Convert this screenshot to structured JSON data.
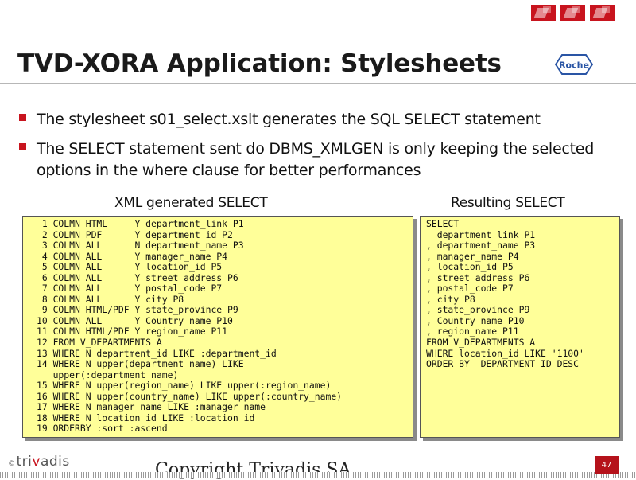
{
  "slide": {
    "title": "TVD-XORA Application: Stylesheets",
    "partner_logo_text": "Roche",
    "bullets": [
      "The stylesheet s01_select.xslt generates the SQL SELECT statement",
      "The SELECT statement sent do DBMS_XMLGEN is only keeping the selected options in the where clause for better performances"
    ]
  },
  "left_panel": {
    "heading": "XML generated SELECT",
    "lines": [
      " 1 COLMN HTML     Y department_link P1",
      " 2 COLMN PDF      Y department_id P2",
      " 3 COLMN ALL      N department_name P3",
      " 4 COLMN ALL      Y manager_name P4",
      " 5 COLMN ALL      Y location_id P5",
      " 6 COLMN ALL      Y street_address P6",
      " 7 COLMN ALL      Y postal_code P7",
      " 8 COLMN ALL      Y city P8",
      " 9 COLMN HTML/PDF Y state_province P9",
      "10 COLMN ALL      Y Country_name P10",
      "11 COLMN HTML/PDF Y region_name P11",
      "12 FROM V_DEPARTMENTS A",
      "13 WHERE N department_id LIKE :department_id",
      "14 WHERE N upper(department_name) LIKE",
      "   upper(:department_name)",
      "15 WHERE N upper(region_name) LIKE upper(:region_name)",
      "16 WHERE N upper(country_name) LIKE upper(:country_name)",
      "17 WHERE N manager_name LIKE :manager_name",
      "18 WHERE N location_id LIKE :location_id",
      "19 ORDERBY :sort :ascend"
    ]
  },
  "right_panel": {
    "heading": "Resulting SELECT",
    "lines": [
      "SELECT",
      "  department_link P1",
      ", department_name P3",
      ", manager_name P4",
      ", location_id P5",
      ", street_address P6",
      ", postal_code P7",
      ", city P8",
      ", state_province P9",
      ", Country_name P10",
      ", region_name P11",
      "FROM V_DEPARTMENTS A",
      "WHERE location_id LIKE '1100'",
      "ORDER BY  DEPARTMENT_ID DESC"
    ]
  },
  "footer": {
    "copyright_symbol": "©",
    "brand_prefix": "tri",
    "brand_accent": "v",
    "brand_suffix": "adis",
    "copyright": "Copyright Trivadis SA",
    "page_number": "47"
  },
  "colors": {
    "accent_red": "#c8141e",
    "code_background": "#ffff99",
    "roche_blue": "#2a55a5"
  },
  "icons": {
    "header_logos": [
      "corporate-photo-icon",
      "corporate-photo-icon",
      "corporate-photo-icon"
    ],
    "bullet": "red-square-bullet-icon",
    "partner": "roche-hexagon-logo-icon"
  }
}
